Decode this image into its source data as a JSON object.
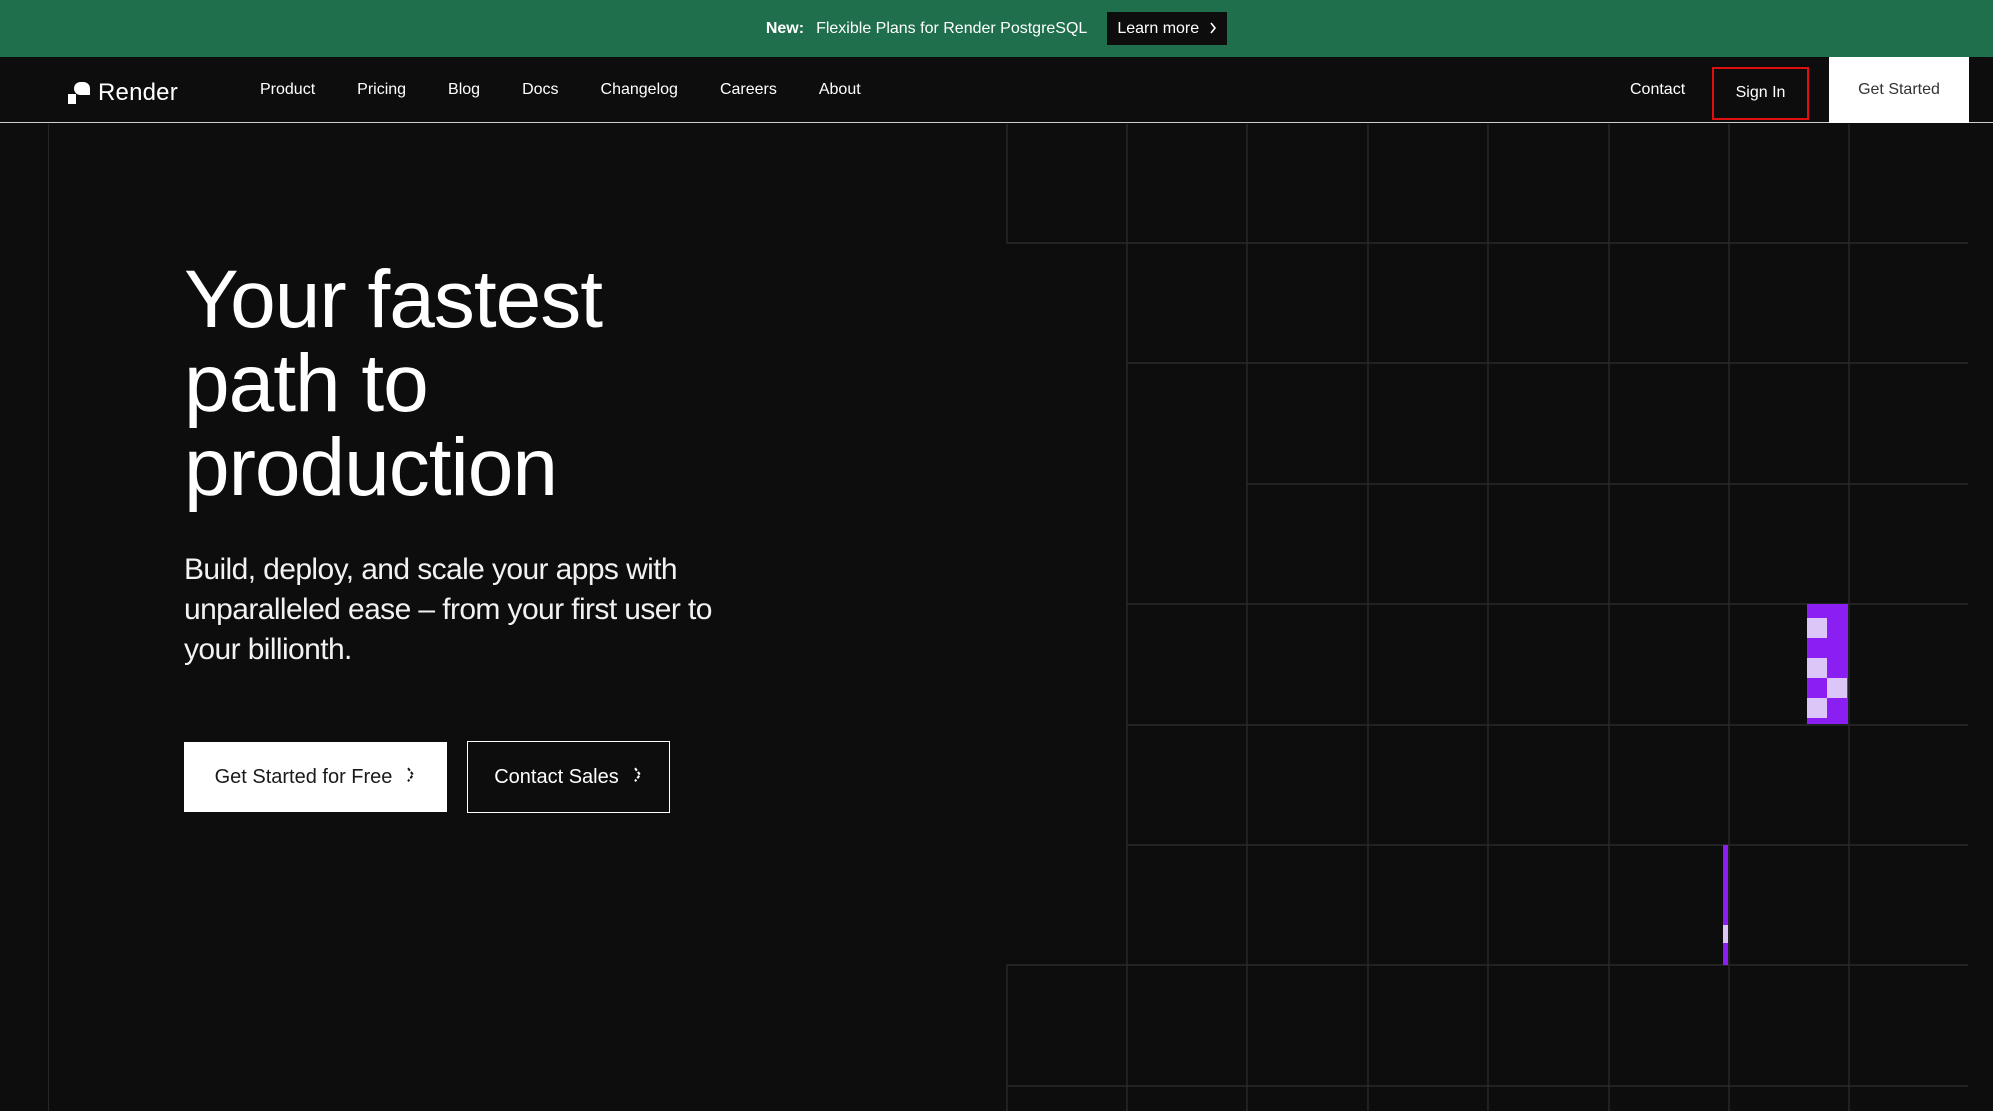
{
  "banner": {
    "new_label": "New:",
    "message": "Flexible Plans for Render PostgreSQL",
    "link_label": "Learn more",
    "background": "#1f6f4c"
  },
  "nav": {
    "logo_text": "Render",
    "links": [
      {
        "label": "Product"
      },
      {
        "label": "Pricing"
      },
      {
        "label": "Blog"
      },
      {
        "label": "Docs"
      },
      {
        "label": "Changelog"
      },
      {
        "label": "Careers"
      },
      {
        "label": "About"
      }
    ],
    "contact_label": "Contact",
    "signin_label": "Sign In",
    "get_started_label": "Get Started"
  },
  "hero": {
    "title": "Your fastest\npath to\nproduction",
    "subtitle": "Build, deploy, and scale your apps with unparalleled ease – from your first user to your billionth.",
    "primary_cta": "Get Started for Free",
    "secondary_cta": "Contact Sales"
  },
  "icons": {
    "banner_chevron": "chevron-right-icon",
    "cta_chevron": "chevron-right-icon"
  },
  "colors": {
    "background": "#0d0d0d",
    "accent_purple": "#8b1ef2",
    "accent_lavender": "#dcc6f7",
    "highlight_red": "#e01010"
  }
}
